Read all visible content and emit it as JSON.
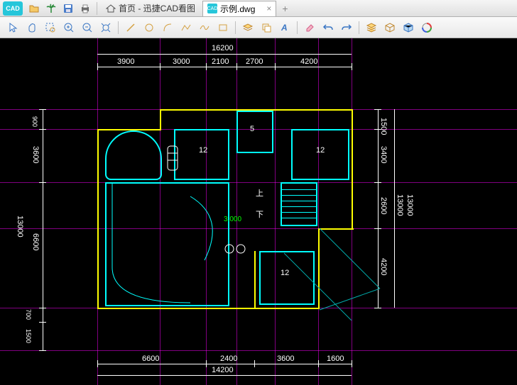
{
  "titlebar": {
    "logo_text": "CAD",
    "home_label": "首页 - 迅捷CAD看图",
    "file_tab_label": "示例.dwg",
    "file_tab_icon": "CAD",
    "close": "×",
    "plus": "+"
  },
  "dims": {
    "top_total": "16200",
    "top_seg": [
      "3900",
      "3000",
      "2100",
      "2700",
      "4200"
    ],
    "right_seg": [
      "1500",
      "3400",
      "2600",
      "4200"
    ],
    "right_total1": "13000",
    "right_total2": "13000",
    "bottom_seg": [
      "6600",
      "2400",
      "3600",
      "1600"
    ],
    "bottom_total": "14200",
    "left_total": "13000",
    "left_seg": [
      "900",
      "3600",
      "6600",
      "700",
      "1500"
    ]
  },
  "rooms": {
    "r1": "12",
    "r2": "12",
    "r3": "12",
    "bath": "5",
    "up": "上",
    "down": "下",
    "level": "3.000"
  }
}
